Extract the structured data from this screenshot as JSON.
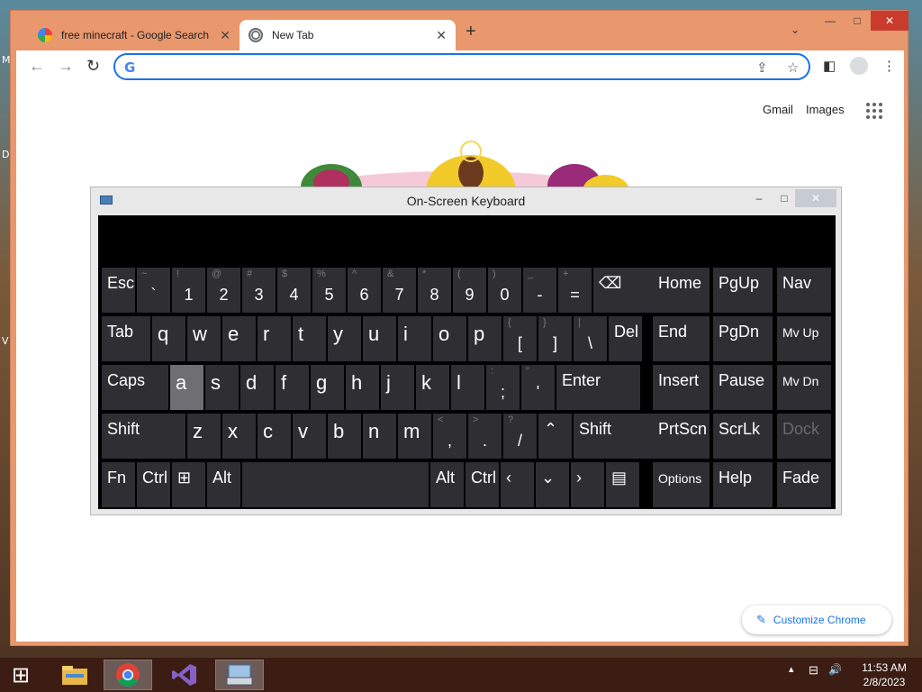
{
  "desktop": {
    "icon_letters": [
      "M",
      "D",
      "V"
    ]
  },
  "chrome": {
    "tabs": [
      {
        "label": "free minecraft - Google Search",
        "icon": "google-icon",
        "active": false
      },
      {
        "label": "New Tab",
        "icon": "chrome-icon",
        "active": true
      }
    ],
    "new_tab_symbol": "+",
    "tab_menu_symbol": "⌄",
    "window_controls": {
      "minimize": "—",
      "maximize": "□",
      "close": "✕"
    },
    "toolbar": {
      "back": "←",
      "forward": "→",
      "reload": "↻",
      "google_g": "G",
      "omnibox_value": "",
      "omnibox_placeholder": "",
      "share": "⇪",
      "bookmark": "☆",
      "side_panel": "◧",
      "menu": "⋮"
    },
    "top_links": {
      "gmail": "Gmail",
      "images": "Images"
    },
    "customize": {
      "icon": "✎",
      "label": "Customize Chrome"
    }
  },
  "osk": {
    "title": "On-Screen Keyboard",
    "controls": {
      "minimize": "–",
      "maximize": "□",
      "close": "✕"
    },
    "rows": [
      [
        [
          "Esc",
          ""
        ],
        [
          "`",
          "~"
        ],
        [
          "1",
          "!"
        ],
        [
          "2",
          "@"
        ],
        [
          "3",
          "#"
        ],
        [
          "4",
          "$"
        ],
        [
          "5",
          "%"
        ],
        [
          "6",
          "^"
        ],
        [
          "7",
          "&"
        ],
        [
          "8",
          "*"
        ],
        [
          "9",
          "("
        ],
        [
          "0",
          ")"
        ],
        [
          "-",
          "_"
        ],
        [
          "=",
          "+"
        ],
        [
          "⌫",
          ""
        ]
      ],
      [
        [
          "Tab",
          ""
        ],
        [
          "q",
          ""
        ],
        [
          "w",
          ""
        ],
        [
          "e",
          ""
        ],
        [
          "r",
          ""
        ],
        [
          "t",
          ""
        ],
        [
          "y",
          ""
        ],
        [
          "u",
          ""
        ],
        [
          "i",
          ""
        ],
        [
          "o",
          ""
        ],
        [
          "p",
          ""
        ],
        [
          "[",
          "{"
        ],
        [
          "]",
          "}"
        ],
        [
          "\\",
          "|"
        ],
        [
          "Del",
          ""
        ]
      ],
      [
        [
          "Caps",
          ""
        ],
        [
          "a",
          ""
        ],
        [
          "s",
          ""
        ],
        [
          "d",
          ""
        ],
        [
          "f",
          ""
        ],
        [
          "g",
          ""
        ],
        [
          "h",
          ""
        ],
        [
          "j",
          ""
        ],
        [
          "k",
          ""
        ],
        [
          "l",
          ""
        ],
        [
          ";",
          ":"
        ],
        [
          "'",
          "\""
        ],
        [
          "Enter",
          ""
        ]
      ],
      [
        [
          "Shift",
          ""
        ],
        [
          "z",
          ""
        ],
        [
          "x",
          ""
        ],
        [
          "c",
          ""
        ],
        [
          "v",
          ""
        ],
        [
          "b",
          ""
        ],
        [
          "n",
          ""
        ],
        [
          "m",
          ""
        ],
        [
          ",",
          "<"
        ],
        [
          ".",
          ">"
        ],
        [
          "/",
          "?"
        ],
        [
          "⌃",
          ""
        ],
        [
          "Shift",
          ""
        ]
      ],
      [
        [
          "Fn",
          ""
        ],
        [
          "Ctrl",
          ""
        ],
        [
          "⊞",
          ""
        ],
        [
          "Alt",
          ""
        ],
        [
          "",
          ""
        ],
        [
          "Alt",
          ""
        ],
        [
          "Ctrl",
          ""
        ],
        [
          "‹",
          ""
        ],
        [
          "⌄",
          ""
        ],
        [
          "›",
          ""
        ],
        [
          "▤",
          ""
        ]
      ]
    ],
    "nav_keys": [
      [
        "Home",
        "PgUp",
        "Nav"
      ],
      [
        "End",
        "PgDn",
        "Mv Up"
      ],
      [
        "Insert",
        "Pause",
        "Mv Dn"
      ],
      [
        "PrtScn",
        "ScrLk",
        "Dock"
      ],
      [
        "Options",
        "Help",
        "Fade"
      ]
    ],
    "highlighted_key": "a",
    "disabled_key": "Dock"
  },
  "taskbar": {
    "start": "⊞",
    "apps": [
      "file-explorer-icon",
      "chrome-icon",
      "visual-studio-icon",
      "on-screen-keyboard-icon"
    ],
    "tray": {
      "up": "▴",
      "network": "⊟",
      "volume": "🔊"
    },
    "time": "11:53 AM",
    "date": "2/8/2023"
  },
  "colors": {
    "accent": "#1a73e8",
    "key_bg": "#2e2e33",
    "key_hl": "#6e6e73",
    "taskbar": "#3b1d14",
    "tabbar": "#e9976d"
  }
}
